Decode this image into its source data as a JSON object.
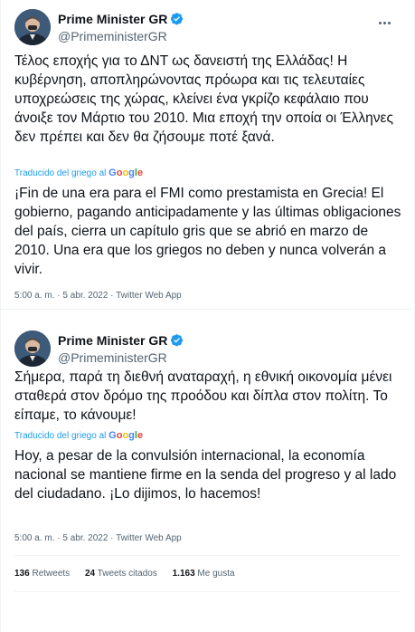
{
  "tweets": [
    {
      "display_name": "Prime Minister GR",
      "handle": "@PrimeministerGR",
      "original_text": "Τέλος εποχής για το ΔΝΤ ως δανειστή της Ελλάδας! Η κυβέρνηση, αποπληρώνοντας πρόωρα και τις τελευταίες υποχρεώσεις της χώρας, κλείνει ένα γκρίζο κεφάλαιο που άνοιξε τον Μάρτιο του 2010. Μια εποχή την οποία οι Έλληνες δεν πρέπει και δεν θα ζήσουμε ποτέ ξανά.",
      "translated_label": "Traducido del griego al",
      "translated_text": "¡Fin de una era para el FMI como prestamista en Grecia! El gobierno, pagando anticipadamente y las últimas obligaciones del país, cierra un capítulo gris que se abrió en marzo de 2010. Una era que los griegos no deben y nunca volverán a vivir.",
      "timestamp": "5:00 a. m. · 5 abr. 2022 · Twitter Web App"
    },
    {
      "display_name": "Prime Minister GR",
      "handle": "@PrimeministerGR",
      "original_text": "Σήμερα, παρά τη διεθνή αναταραχή, η εθνική οικονομία μένει σταθερά στον δρόμο της προόδου και δίπλα στον πολίτη. Το είπαμε, το κάνουμε!",
      "translated_label": "Traducido del griego al",
      "translated_text": "Hoy, a pesar de la convulsión internacional, la economía nacional se mantiene firme en la senda del progreso y al lado del ciudadano. ¡Lo dijimos, lo hacemos!",
      "timestamp": "5:00 a. m. · 5 abr. 2022 · Twitter Web App"
    }
  ],
  "google_logo": "Google",
  "stats": {
    "retweets_count": "136",
    "retweets_label": "Retweets",
    "quotes_count": "24",
    "quotes_label": "Tweets citados",
    "likes_count": "1.163",
    "likes_label": "Me gusta"
  },
  "colors": {
    "accent": "#1d9bf0",
    "text": "#0f1419",
    "secondary": "#536471",
    "divider": "#eff3f4"
  },
  "icons": {
    "verified": "verified-badge-icon",
    "more": "more-options-icon"
  }
}
